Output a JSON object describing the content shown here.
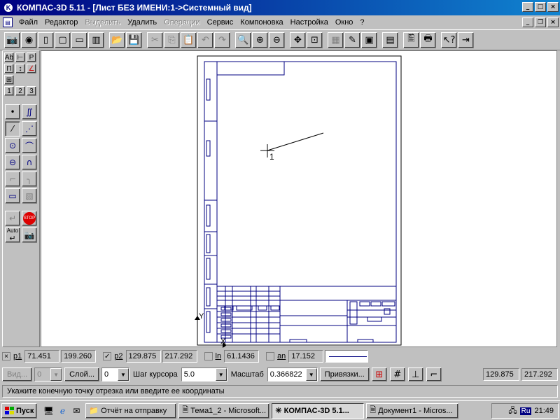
{
  "window": {
    "title": "КОМПАС-3D 5.11 - [Лист БЕЗ ИМЕНИ:1->Системный вид]",
    "app_icon": "K"
  },
  "menu": [
    "Файл",
    "Редактор",
    "Выделить",
    "Удалить",
    "Операции",
    "Сервис",
    "Компоновка",
    "Настройка",
    "Окно",
    "?"
  ],
  "left_panel": {
    "tabs": [
      "1",
      "2",
      "3"
    ]
  },
  "canvas": {
    "point_label": "1",
    "axis_y": "Y",
    "axis_x": "X"
  },
  "status1": {
    "p1_label": "p1",
    "p1_x": "71.451",
    "p1_y": "199.260",
    "p2_label": "p2",
    "p2_x": "129.875",
    "p2_y": "217.292",
    "ln_label": "ln",
    "ln_val": "61.1436",
    "an_label": "an",
    "an_val": "17.152"
  },
  "status2": {
    "vid_label": "Вид...",
    "vid_val": "0",
    "layer_label": "Слой...",
    "layer_val": "0",
    "step_label": "Шаг курсора",
    "step_val": "5.0",
    "scale_label": "Масштаб",
    "scale_val": "0.366822",
    "snap_label": "Привязки...",
    "cur_x": "129.875",
    "cur_y": "217.292"
  },
  "prompt": "Укажите конечную точку отрезка или введите ее координаты",
  "taskbar": {
    "start": "Пуск",
    "tasks": [
      "Отчёт на отправку",
      "Тема1_2 - Microsoft...",
      "КОМПАС-3D 5.1...",
      "Документ1 - Micros..."
    ],
    "lang": "Ru",
    "clock": "21:49"
  }
}
